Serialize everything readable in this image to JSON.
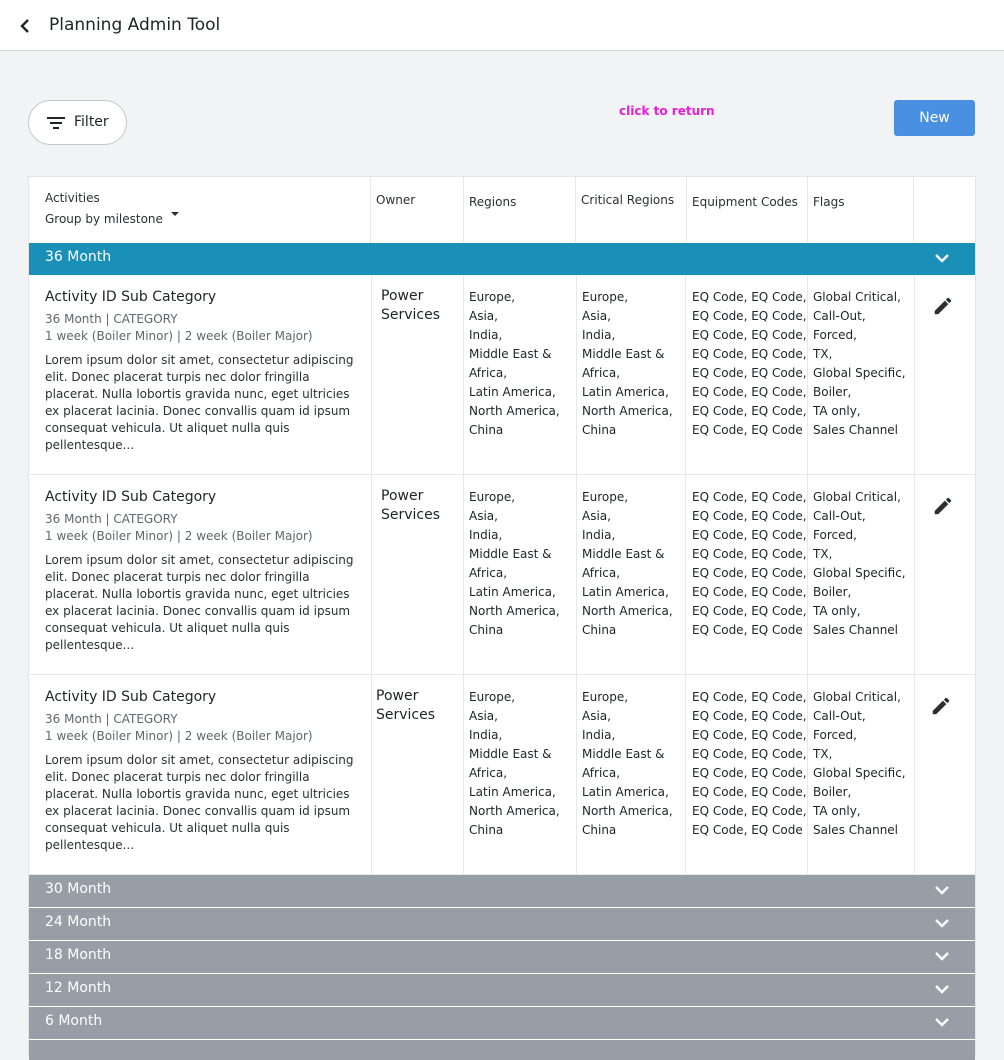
{
  "header": {
    "title": "Planning Admin Tool",
    "back_icon": "chevron-left-icon"
  },
  "toolbar": {
    "filter_label": "Filter",
    "filter_icon": "filter-icon",
    "return_link": "click to return",
    "new_label": "New"
  },
  "colors": {
    "group_active": "#1a8fb8",
    "group_collapsed": "#979ea6",
    "new_button": "#4a90e2",
    "return_link": "#e91edc"
  },
  "table": {
    "columns": {
      "activities": "Activities",
      "group_by": "Group by milestone",
      "owner": "Owner",
      "regions": "Regions",
      "critical_regions": "Critical Regions",
      "equipment_codes": "Equipment Codes",
      "flags": "Flags"
    },
    "groups": [
      {
        "label": "36 Month",
        "rows": [
          {
            "title": "Activity ID Sub Category",
            "meta": "36 Month | CATEGORY",
            "duration": "1 week (Boiler Minor) | 2 week (Boiler Major)",
            "description": "Lorem ipsum dolor sit amet, consectetur adipiscing elit. Donec placerat turpis nec dolor fringilla placerat. Nulla lobortis gravida nunc, eget ultricies ex placerat lacinia. Donec convallis quam id ipsum consequat vehicula. Ut aliquet nulla quis pellentesque...",
            "owner": "Power Services",
            "regions": "Europe,\nAsia,\nIndia,\nMiddle East &\nAfrica,\nLatin America,\nNorth America,\nChina",
            "critical_regions": "Europe,\nAsia,\nIndia,\nMiddle East &\nAfrica,\nLatin America,\nNorth America,\nChina",
            "equipment_codes": "EQ Code, EQ Code,\nEQ Code, EQ Code,\nEQ Code, EQ Code,\nEQ Code, EQ Code,\nEQ Code, EQ Code,\nEQ Code, EQ Code,\nEQ Code, EQ Code,\nEQ Code, EQ Code",
            "flags": "Global Critical,\nCall-Out,\nForced,\nTX,\nGlobal Specific,\nBoiler,\nTA only,\nSales Channel"
          },
          {
            "title": "Activity ID Sub Category",
            "meta": "36 Month | CATEGORY",
            "duration": "1 week (Boiler Minor) | 2 week (Boiler Major)",
            "description": "Lorem ipsum dolor sit amet, consectetur adipiscing elit. Donec placerat turpis nec dolor fringilla placerat. Nulla lobortis gravida nunc, eget ultricies ex placerat lacinia. Donec convallis quam id ipsum consequat vehicula. Ut aliquet nulla quis pellentesque...",
            "owner": "Power Services",
            "regions": "Europe,\nAsia,\nIndia,\nMiddle East &\nAfrica,\nLatin America,\nNorth America,\nChina",
            "critical_regions": "Europe,\nAsia,\nIndia,\nMiddle East &\nAfrica,\nLatin America,\nNorth America,\nChina",
            "equipment_codes": "EQ Code, EQ Code,\nEQ Code, EQ Code,\nEQ Code, EQ Code,\nEQ Code, EQ Code,\nEQ Code, EQ Code,\nEQ Code, EQ Code,\nEQ Code, EQ Code,\nEQ Code, EQ Code",
            "flags": "Global Critical,\nCall-Out,\nForced,\nTX,\nGlobal Specific,\nBoiler,\nTA only,\nSales Channel"
          },
          {
            "title": "Activity ID Sub Category",
            "meta": "36 Month | CATEGORY",
            "duration": "1 week (Boiler Minor) | 2 week (Boiler Major)",
            "description": "Lorem ipsum dolor sit amet, consectetur adipiscing elit. Donec placerat turpis nec dolor fringilla placerat. Nulla lobortis gravida nunc, eget ultricies ex placerat lacinia. Donec convallis quam id ipsum consequat vehicula. Ut aliquet nulla quis pellentesque...",
            "owner": "Power Services",
            "regions": "Europe,\nAsia,\nIndia,\nMiddle East &\nAfrica,\nLatin America,\nNorth America,\nChina",
            "critical_regions": "Europe,\nAsia,\nIndia,\nMiddle East &\nAfrica,\nLatin America,\nNorth America,\nChina",
            "equipment_codes": "EQ Code, EQ Code,\nEQ Code, EQ Code,\nEQ Code, EQ Code,\nEQ Code, EQ Code,\nEQ Code, EQ Code,\nEQ Code, EQ Code,\nEQ Code, EQ Code,\nEQ Code, EQ Code",
            "flags": "Global Critical,\nCall-Out,\nForced,\nTX,\nGlobal Specific,\nBoiler,\nTA only,\nSales Channel"
          }
        ]
      },
      {
        "label": "30 Month"
      },
      {
        "label": "24 Month"
      },
      {
        "label": "18 Month"
      },
      {
        "label": "12 Month"
      },
      {
        "label": "6 Month"
      }
    ]
  }
}
